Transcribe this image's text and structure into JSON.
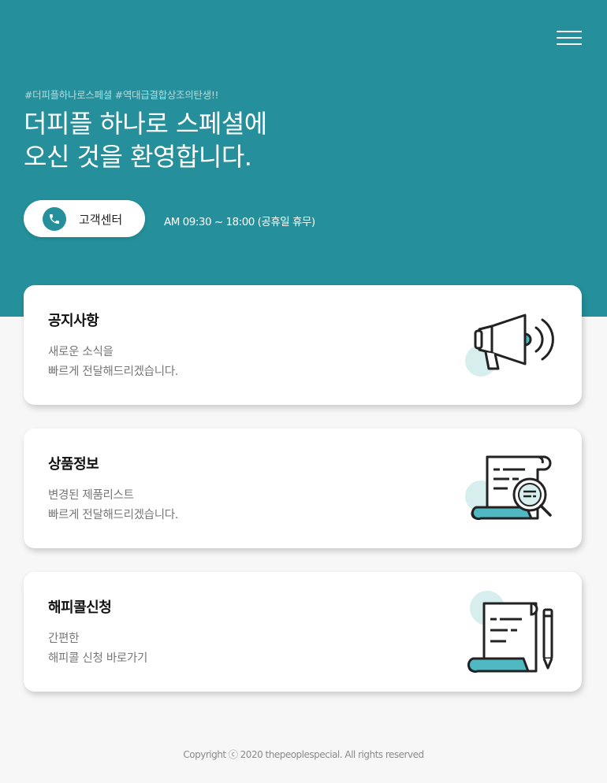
{
  "header": {
    "menu_icon": "hamburger-menu-icon",
    "hashtags": "#더피플하나로스페셜 #역대급결합상조의탄생!!",
    "title_line1": "더피플 하나로 스페셜에",
    "title_line2": "오신 것을 환영합니다.",
    "cs_icon": "phone-icon",
    "cs_label": "고객센터",
    "hours": "AM 09:30 ~ 18:00 (공휴일 휴무)"
  },
  "colors": {
    "brand": "#25909b",
    "accent_light": "#d6eeee",
    "accent_mid": "#4fb8c2"
  },
  "cards": [
    {
      "title": "공지사항",
      "desc_line1": "새로운 소식을",
      "desc_line2": "빠르게 전달해드리겠습니다.",
      "icon": "megaphone-icon"
    },
    {
      "title": "상품정보",
      "desc_line1": "변경된 제품리스트",
      "desc_line2": "빠르게 전달해드리겠습니다.",
      "icon": "document-search-icon"
    },
    {
      "title": "해피콜신청",
      "desc_line1": "간편한",
      "desc_line2": "해피콜 신청 바로가기",
      "icon": "scroll-pencil-icon"
    }
  ],
  "footer": {
    "copyright": "Copyright ⓒ 2020 thepeoplespecial. All rights reserved"
  }
}
